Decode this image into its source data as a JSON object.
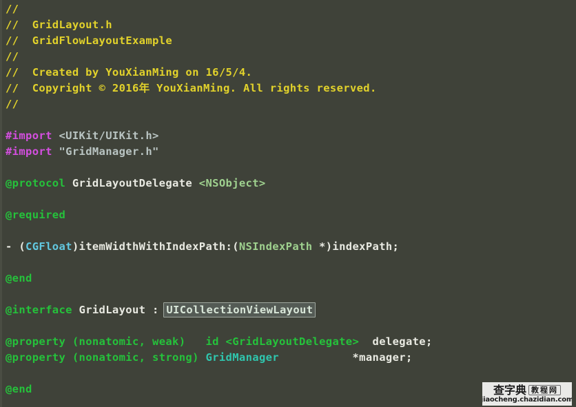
{
  "editor": {
    "background_color": "#3f4239",
    "gutter_color": "#4a4d43",
    "font_size_px": 15.5,
    "line_height_px": 23,
    "language": "objective-c",
    "file_name": "GridLayout.h"
  },
  "colors": {
    "comment": "#e2d22b",
    "preprocessor": "#d44fe0",
    "import_path": "#b9c4c2",
    "keyword": "#25c23b",
    "plain_text": "#e9eae2",
    "type_pale_green": "#9fd18f",
    "type_cyan": "#62c8e0",
    "type_teal": "#2fc6ae",
    "selection_background": "#545b55",
    "selection_border": "#9fa8a0"
  },
  "code": {
    "lines": [
      {
        "n": 1,
        "tokens": [
          {
            "t": "//",
            "c": "comment"
          }
        ]
      },
      {
        "n": 2,
        "tokens": [
          {
            "t": "//  GridLayout.h",
            "c": "comment"
          }
        ]
      },
      {
        "n": 3,
        "tokens": [
          {
            "t": "//  GridFlowLayoutExample",
            "c": "comment"
          }
        ]
      },
      {
        "n": 4,
        "tokens": [
          {
            "t": "//",
            "c": "comment"
          }
        ]
      },
      {
        "n": 5,
        "tokens": [
          {
            "t": "//  Created by YouXianMing on 16/5/4.",
            "c": "comment"
          }
        ]
      },
      {
        "n": 6,
        "tokens": [
          {
            "t": "//  Copyright © 2016年 YouXianMing. All rights reserved.",
            "c": "comment"
          }
        ]
      },
      {
        "n": 7,
        "tokens": [
          {
            "t": "//",
            "c": "comment"
          }
        ]
      },
      {
        "n": 8,
        "tokens": []
      },
      {
        "n": 9,
        "tokens": [
          {
            "t": "#import",
            "c": "pre"
          },
          {
            "t": " ",
            "c": "plain"
          },
          {
            "t": "<UIKit/UIKit.h>",
            "c": "path"
          }
        ]
      },
      {
        "n": 10,
        "tokens": [
          {
            "t": "#import",
            "c": "pre"
          },
          {
            "t": " ",
            "c": "plain"
          },
          {
            "t": "\"GridManager.h\"",
            "c": "path"
          }
        ]
      },
      {
        "n": 11,
        "tokens": []
      },
      {
        "n": 12,
        "tokens": [
          {
            "t": "@protocol",
            "c": "key"
          },
          {
            "t": " GridLayoutDelegate ",
            "c": "plain"
          },
          {
            "t": "<NSObject>",
            "c": "type1"
          }
        ]
      },
      {
        "n": 13,
        "tokens": []
      },
      {
        "n": 14,
        "tokens": [
          {
            "t": "@required",
            "c": "key"
          }
        ]
      },
      {
        "n": 15,
        "tokens": []
      },
      {
        "n": 16,
        "tokens": [
          {
            "t": "- (",
            "c": "plain"
          },
          {
            "t": "CGFloat",
            "c": "type2"
          },
          {
            "t": ")itemWidthWithIndexPath:(",
            "c": "plain"
          },
          {
            "t": "NSIndexPath",
            "c": "type1"
          },
          {
            "t": " *)indexPath;",
            "c": "plain"
          }
        ]
      },
      {
        "n": 17,
        "tokens": []
      },
      {
        "n": 18,
        "tokens": [
          {
            "t": "@end",
            "c": "key"
          }
        ]
      },
      {
        "n": 19,
        "tokens": []
      },
      {
        "n": 20,
        "tokens": [
          {
            "t": "@interface",
            "c": "key"
          },
          {
            "t": " GridLayout : ",
            "c": "plain"
          },
          {
            "t": "UICollectionViewLayout",
            "c": "selected"
          }
        ]
      },
      {
        "n": 21,
        "tokens": []
      },
      {
        "n": 22,
        "tokens": [
          {
            "t": "@property",
            "c": "key"
          },
          {
            "t": " ",
            "c": "plain"
          },
          {
            "t": "(nonatomic, weak)",
            "c": "key"
          },
          {
            "t": "   ",
            "c": "plain"
          },
          {
            "t": "id",
            "c": "key"
          },
          {
            "t": " ",
            "c": "plain"
          },
          {
            "t": "<GridLayoutDelegate>",
            "c": "key"
          },
          {
            "t": "  delegate;",
            "c": "plain"
          }
        ]
      },
      {
        "n": 23,
        "tokens": [
          {
            "t": "@property",
            "c": "key"
          },
          {
            "t": " ",
            "c": "plain"
          },
          {
            "t": "(nonatomic, strong)",
            "c": "key"
          },
          {
            "t": " ",
            "c": "plain"
          },
          {
            "t": "GridManager",
            "c": "type3"
          },
          {
            "t": "           *manager;",
            "c": "plain"
          }
        ]
      },
      {
        "n": 24,
        "tokens": []
      },
      {
        "n": 25,
        "tokens": [
          {
            "t": "@end",
            "c": "key"
          }
        ]
      }
    ],
    "selection": {
      "text": "UICollectionViewLayout",
      "line": 20
    }
  },
  "watermark": {
    "brand_cn": "查字典",
    "brand_cn_boxed": "教程网",
    "url": "jiaocheng.chazidian.com"
  }
}
